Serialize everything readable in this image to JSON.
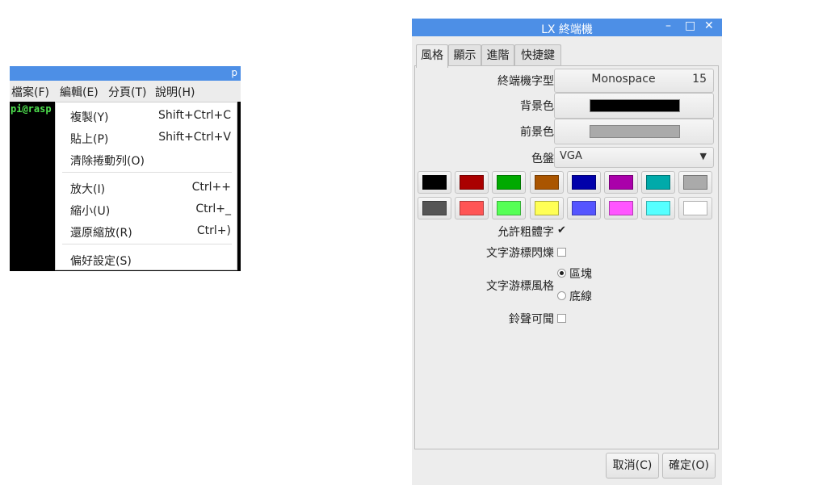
{
  "terminal": {
    "title_fragment": "p",
    "menubar": [
      "檔案(F)",
      "編輯(E)",
      "分頁(T)",
      "說明(H)"
    ],
    "prompt": "pi@rasp",
    "edit_menu": [
      {
        "label": "複製(Y)",
        "accel": "Shift+Ctrl+C"
      },
      {
        "label": "貼上(P)",
        "accel": "Shift+Ctrl+V"
      },
      {
        "label": "清除捲動列(O)",
        "accel": ""
      },
      {
        "label": "放大(I)",
        "accel": "Ctrl++"
      },
      {
        "label": "縮小(U)",
        "accel": "Ctrl+_"
      },
      {
        "label": "還原縮放(R)",
        "accel": "Ctrl+)"
      },
      {
        "label": "偏好設定(S)",
        "accel": ""
      }
    ]
  },
  "dialog": {
    "title": "LX 終端機",
    "window_buttons": {
      "minimize": "–",
      "maximize": "□",
      "close": "✕"
    },
    "tabs": [
      "風格",
      "顯示",
      "進階",
      "快捷鍵"
    ],
    "active_tab": "風格",
    "font": {
      "label": "終端機字型",
      "name": "Monospace",
      "size": "15"
    },
    "background": {
      "label": "背景色",
      "color": "#000000"
    },
    "foreground": {
      "label": "前景色",
      "color": "#aaaaaa"
    },
    "palette": {
      "label": "色盤",
      "selected": "VGA",
      "colors": [
        "#000000",
        "#aa0000",
        "#00aa00",
        "#aa5500",
        "#0000aa",
        "#aa00aa",
        "#00aaaa",
        "#aaaaaa",
        "#555555",
        "#ff5555",
        "#55ff55",
        "#ffff55",
        "#5555ff",
        "#ff55ff",
        "#55ffff",
        "#ffffff"
      ]
    },
    "allow_bold": {
      "label": "允許粗體字",
      "checked": true,
      "mark": "✔"
    },
    "cursor_blink": {
      "label": "文字游標閃爍",
      "checked": false
    },
    "cursor_style": {
      "label": "文字游標風格",
      "options": [
        "區塊",
        "底線"
      ],
      "selected": "區塊"
    },
    "audible_bell": {
      "label": "鈴聲可聞",
      "checked": false
    },
    "buttons": {
      "cancel": "取消(C)",
      "ok": "確定(O)"
    },
    "accent": "#4d8fe6"
  }
}
